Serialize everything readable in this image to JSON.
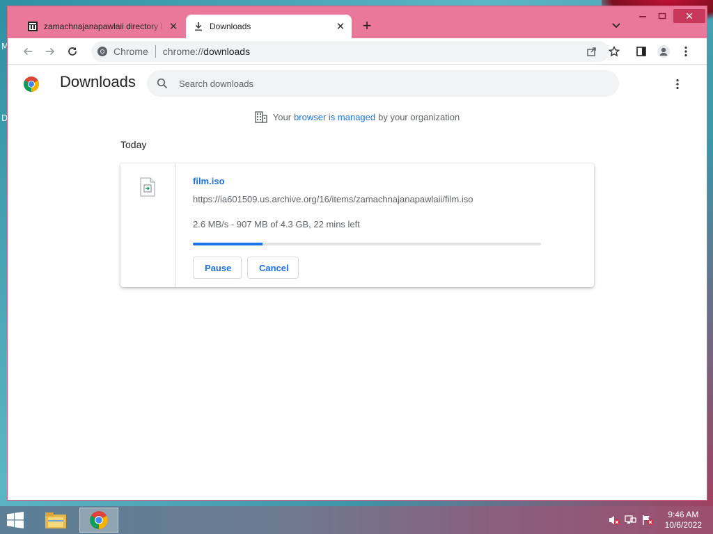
{
  "browser": {
    "tabs": [
      {
        "title": "zamachnajanapawlaii directory l",
        "icon": "archive-icon",
        "active": false
      },
      {
        "title": "Downloads",
        "icon": "download-icon",
        "active": true
      }
    ],
    "omnibox": {
      "site_label": "Chrome",
      "url_scheme": "chrome://",
      "url_path": "downloads"
    }
  },
  "page": {
    "title": "Downloads",
    "search_placeholder": "Search downloads",
    "managed_notice": {
      "prefix": "Your",
      "link": "browser is managed",
      "suffix": "by your organization"
    },
    "day_label": "Today"
  },
  "download": {
    "filename": "film.iso",
    "url": "https://ia601509.us.archive.org/16/items/zamachnajanapawlaii/film.iso",
    "status": "2.6 MB/s - 907 MB of 4.3 GB, 22 mins left",
    "progress_percent": 20,
    "pause_label": "Pause",
    "cancel_label": "Cancel"
  },
  "desktop": {
    "edge_letters": [
      "M",
      "D"
    ]
  },
  "taskbar": {
    "apps": [
      "file-explorer-icon",
      "chrome-icon"
    ],
    "clock_time": "9:46 AM",
    "clock_date": "10/6/2022"
  },
  "colors": {
    "accent": "#1a73e8",
    "frame": "#e9789a"
  }
}
